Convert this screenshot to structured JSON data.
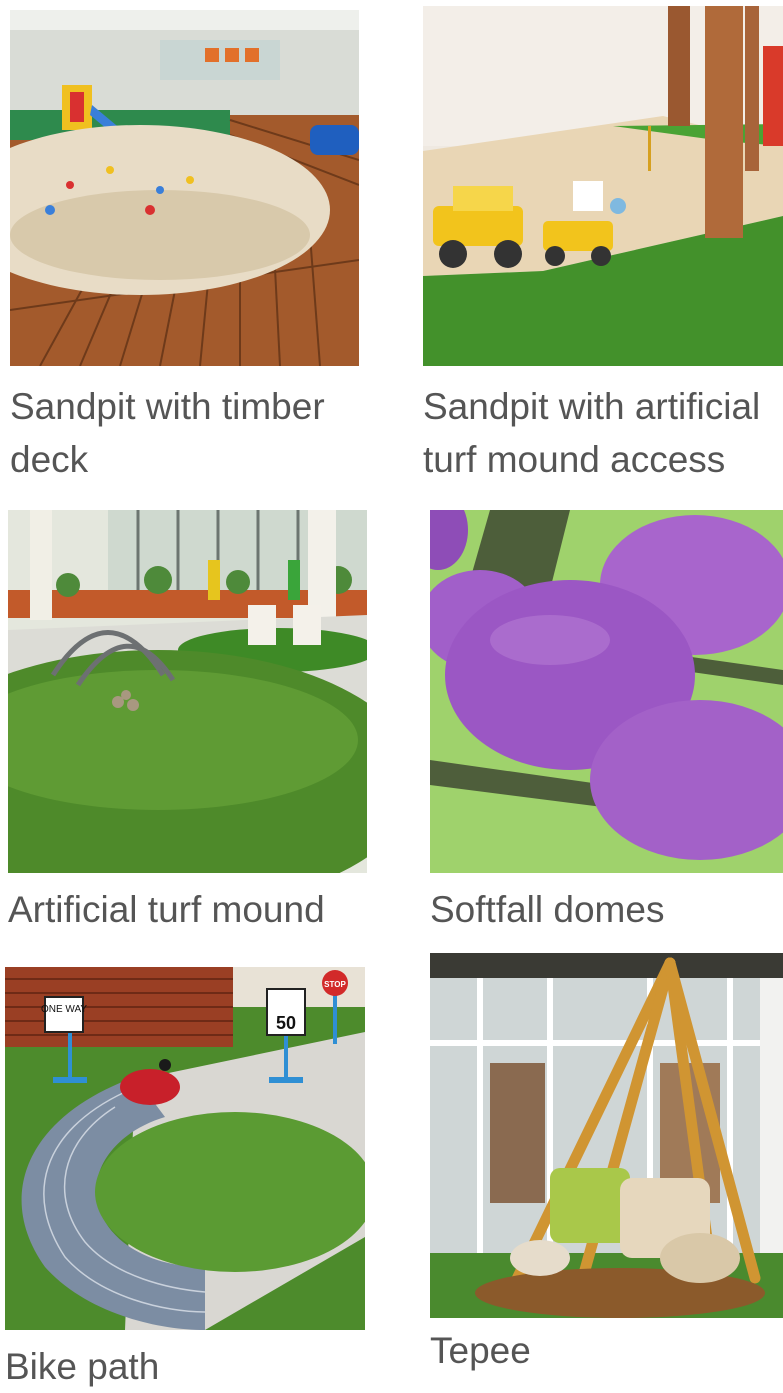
{
  "gallery": {
    "items": [
      {
        "caption": "Sandpit with timber deck"
      },
      {
        "caption": "Sandpit with artificial turf mound access"
      },
      {
        "caption": "Artificial turf mound"
      },
      {
        "caption": "Softfall domes"
      },
      {
        "caption": "Bike path"
      },
      {
        "caption": "Tepee"
      }
    ]
  },
  "signs": {
    "one_way": "ONE WAY",
    "speed": "50",
    "stop": "STOP"
  },
  "colors": {
    "caption_text": "#555555",
    "turf_green": "#4e8a2a",
    "timber": "#a0582b",
    "sand": "#e8dcc6",
    "dome_purple": "#a15fc9"
  }
}
